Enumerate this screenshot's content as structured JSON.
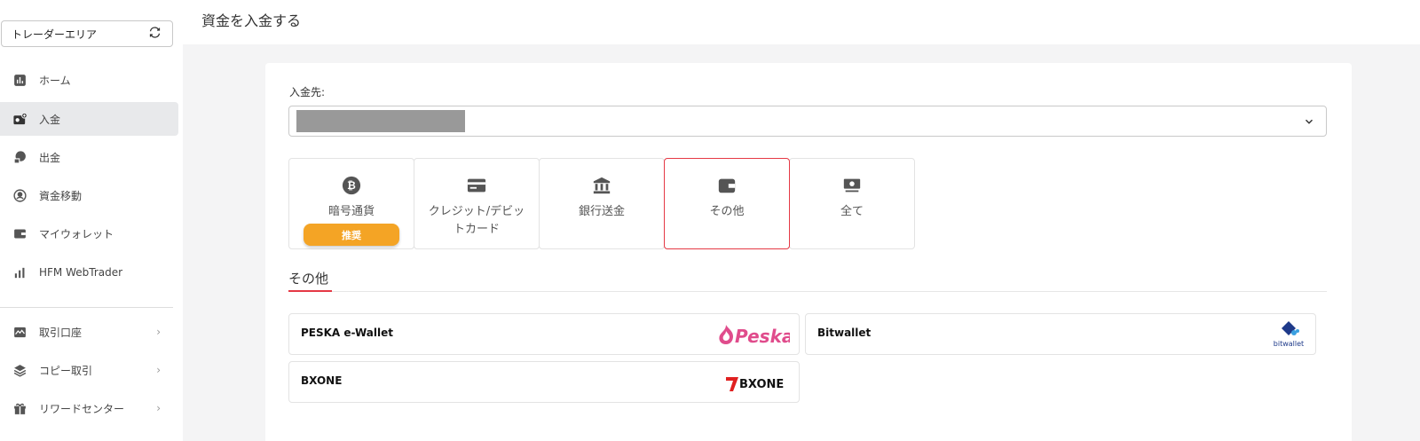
{
  "sidebar": {
    "area_select": "トレーダーエリア",
    "items": [
      {
        "label": "ホーム",
        "icon": "chart-icon"
      },
      {
        "label": "入金",
        "icon": "wallet-plus-icon",
        "active": true
      },
      {
        "label": "出金",
        "icon": "coin-out-icon"
      },
      {
        "label": "資金移動",
        "icon": "transfer-icon"
      },
      {
        "label": "マイウォレット",
        "icon": "wallet-icon"
      },
      {
        "label": "HFM WebTrader",
        "icon": "bars-icon"
      },
      {
        "label": "取引口座",
        "icon": "account-chart-icon",
        "has_chevron": true
      },
      {
        "label": "コピー取引",
        "icon": "layers-icon",
        "has_chevron": true
      },
      {
        "label": "リワードセンター",
        "icon": "gift-icon",
        "has_chevron": true
      }
    ]
  },
  "header": {
    "title": "資金を入金する"
  },
  "deposit": {
    "to_label": "入金先:",
    "methods": [
      {
        "label": "暗号通貨",
        "icon": "bitcoin-icon",
        "badge": "推奨"
      },
      {
        "label": "クレジット/デビットカード",
        "icon": "credit-card-icon"
      },
      {
        "label": "銀行送金",
        "icon": "bank-icon"
      },
      {
        "label": "その他",
        "icon": "wallet-icon",
        "selected": true
      },
      {
        "label": "全て",
        "icon": "cash-icon"
      }
    ],
    "section_title": "その他",
    "providers": [
      {
        "name": "PESKA e-Wallet",
        "logo_text": "Peska"
      },
      {
        "name": "Bitwallet",
        "logo_text": "bitwallet"
      },
      {
        "name": "BXONE",
        "logo_text": "BXONE"
      }
    ]
  },
  "colors": {
    "accent": "#e53945",
    "badge": "#f4a425",
    "active_bg": "#e8e9eb"
  }
}
